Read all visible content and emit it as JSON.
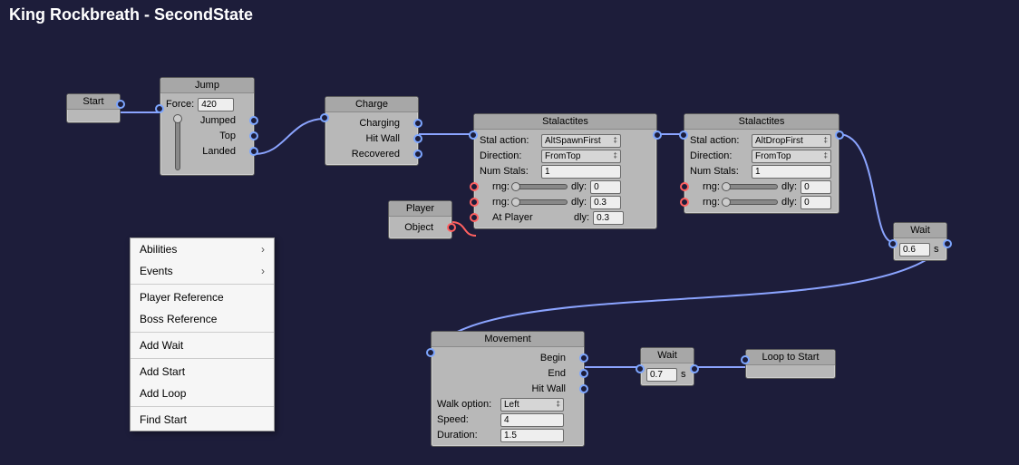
{
  "title": "King Rockbreath - SecondState",
  "nodes": {
    "start": {
      "title": "Start"
    },
    "jump": {
      "title": "Jump",
      "force_label": "Force:",
      "force_value": "420",
      "out_jumped": "Jumped",
      "out_top": "Top",
      "out_landed": "Landed"
    },
    "charge": {
      "title": "Charge",
      "out_charging": "Charging",
      "out_hitwall": "Hit Wall",
      "out_recovered": "Recovered"
    },
    "player": {
      "title": "Player",
      "out_object": "Object"
    },
    "stal1": {
      "title": "Stalactites",
      "stal_action_label": "Stal action:",
      "stal_action_value": "AltSpawnFirst",
      "direction_label": "Direction:",
      "direction_value": "FromTop",
      "num_stals_label": "Num Stals:",
      "num_stals_value": "1",
      "rng_label": "rng:",
      "dly_label": "dly:",
      "dly1": "0",
      "dly2": "0.3",
      "atplayer_label": "At Player",
      "dly3": "0.3"
    },
    "stal2": {
      "title": "Stalactites",
      "stal_action_label": "Stal action:",
      "stal_action_value": "AltDropFirst",
      "direction_label": "Direction:",
      "direction_value": "FromTop",
      "num_stals_label": "Num Stals:",
      "num_stals_value": "1",
      "rng_label": "rng:",
      "dly_label": "dly:",
      "dly1": "0",
      "dly2": "0"
    },
    "wait1": {
      "title": "Wait",
      "value": "0.6",
      "unit": "s"
    },
    "movement": {
      "title": "Movement",
      "out_begin": "Begin",
      "out_end": "End",
      "out_hitwall": "Hit Wall",
      "walk_option_label": "Walk option:",
      "walk_option_value": "Left",
      "speed_label": "Speed:",
      "speed_value": "4",
      "duration_label": "Duration:",
      "duration_value": "1.5"
    },
    "wait2": {
      "title": "Wait",
      "value": "0.7",
      "unit": "s"
    },
    "loop": {
      "title": "Loop to Start"
    }
  },
  "ctx": {
    "items": [
      "Abilities",
      "Events",
      "Player Reference",
      "Boss Reference",
      "Add Wait",
      "Add Start",
      "Add Loop",
      "Find Start"
    ]
  }
}
